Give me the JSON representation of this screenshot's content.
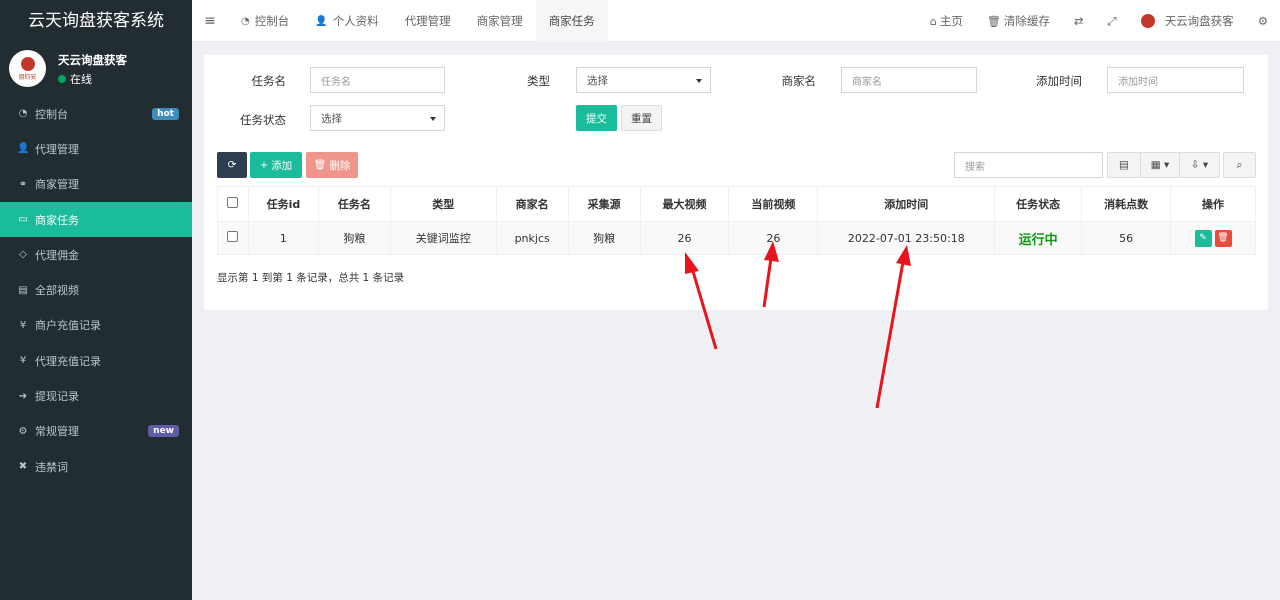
{
  "app": {
    "title": "云天询盘获客系统"
  },
  "user": {
    "name": "天云询盘获客",
    "status": "在线",
    "avatar_text": "朋钧安"
  },
  "sidebar": {
    "items": [
      {
        "label": "控制台",
        "icon": "dashboard-icon",
        "badge": "hot"
      },
      {
        "label": "代理管理",
        "icon": "user-plus-icon"
      },
      {
        "label": "商家管理",
        "icon": "handshake-icon"
      },
      {
        "label": "商家任务",
        "icon": "card-icon",
        "active": true
      },
      {
        "label": "代理佣金",
        "icon": "diamond-icon"
      },
      {
        "label": "全部视频",
        "icon": "file-icon"
      },
      {
        "label": "商户充值记录",
        "icon": "yen-icon"
      },
      {
        "label": "代理充值记录",
        "icon": "yen-icon"
      },
      {
        "label": "提现记录",
        "icon": "sign-in-icon"
      },
      {
        "label": "常规管理",
        "icon": "cogs-icon",
        "badge": "new"
      },
      {
        "label": "违禁词",
        "icon": "close-icon"
      }
    ]
  },
  "topnav": {
    "tabs": [
      {
        "label": "控制台",
        "icon": "dashboard-icon"
      },
      {
        "label": "个人资料",
        "icon": "user-icon"
      },
      {
        "label": "代理管理"
      },
      {
        "label": "商家管理"
      },
      {
        "label": "商家任务",
        "active": true
      }
    ],
    "right": {
      "home": "主页",
      "clear_cache": "清除缓存",
      "account": "天云询盘获客"
    }
  },
  "filters": {
    "task_name_label": "任务名",
    "task_name_placeholder": "任务名",
    "type_label": "类型",
    "type_value": "选择",
    "merchant_label": "商家名",
    "merchant_placeholder": "商家名",
    "time_label": "添加时间",
    "time_placeholder": "添加时间",
    "status_label": "任务状态",
    "status_value": "选择",
    "submit": "提交",
    "reset": "重置"
  },
  "toolbar": {
    "add": "添加",
    "delete": "删除",
    "search_placeholder": "搜索"
  },
  "table": {
    "headers": [
      "任务id",
      "任务名",
      "类型",
      "商家名",
      "采集源",
      "最大视频",
      "当前视频",
      "添加时间",
      "任务状态",
      "消耗点数",
      "操作"
    ],
    "rows": [
      {
        "id": "1",
        "name": "狗粮",
        "type": "关键词监控",
        "merchant": "pnkjcs",
        "source": "狗粮",
        "max_video": "26",
        "current_video": "26",
        "added": "2022-07-01 23:50:18",
        "status": "运行中",
        "points": "56"
      }
    ]
  },
  "pager": {
    "text": "显示第 1 到第 1 条记录，总共 1 条记录"
  },
  "colors": {
    "sidebar": "#222d32",
    "accent": "#1abc9c",
    "running": "#109618",
    "danger": "#e74c3c",
    "arrow": "#e8141b"
  }
}
